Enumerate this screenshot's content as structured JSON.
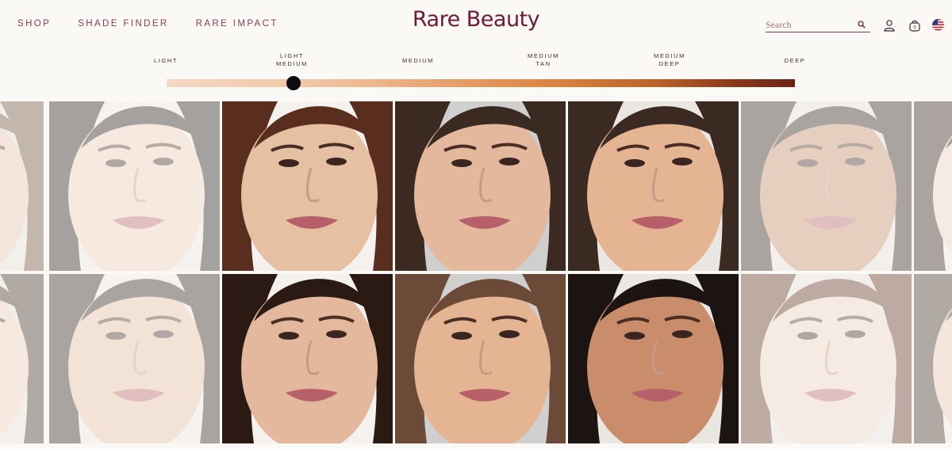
{
  "header": {
    "nav": [
      "SHOP",
      "SHADE FINDER",
      "RARE IMPACT"
    ],
    "logo": "Rare Beauty",
    "search_placeholder": "Search",
    "icons": [
      "search-icon",
      "account-icon",
      "bag-icon",
      "us-flag-icon"
    ],
    "bag_count": "0"
  },
  "shade_finder": {
    "labels": [
      {
        "line1": "LIGHT",
        "line2": ""
      },
      {
        "line1": "LIGHT",
        "line2": "MEDIUM"
      },
      {
        "line1": "MEDIUM",
        "line2": ""
      },
      {
        "line1": "MEDIUM",
        "line2": "TAN"
      },
      {
        "line1": "MEDIUM",
        "line2": "DEEP"
      },
      {
        "line1": "DEEP",
        "line2": ""
      }
    ],
    "selected": "LIGHT MEDIUM",
    "slider_value": 0.2,
    "gradient_colors": [
      "#f5d8c4",
      "#f0c3a2",
      "#e7a06d",
      "#d9843f",
      "#b8632a",
      "#8a3a1c",
      "#6a2216"
    ]
  },
  "colors": {
    "brand": "#6e1a37",
    "nav_text": "#8a3b52",
    "background": "#fbf9f6"
  },
  "grid": {
    "rows": [
      [
        {
          "name": "model-photo",
          "faded": true
        },
        {
          "name": "model-photo",
          "faded": true
        },
        {
          "name": "model-photo",
          "faded": false
        },
        {
          "name": "model-photo",
          "faded": false
        },
        {
          "name": "model-photo",
          "faded": false
        },
        {
          "name": "model-photo",
          "faded": true
        },
        {
          "name": "model-photo",
          "faded": true
        }
      ],
      [
        {
          "name": "model-photo",
          "faded": true
        },
        {
          "name": "model-photo",
          "faded": true
        },
        {
          "name": "model-photo",
          "faded": false
        },
        {
          "name": "model-photo",
          "faded": false
        },
        {
          "name": "model-photo",
          "faded": false
        },
        {
          "name": "model-photo",
          "faded": true
        },
        {
          "name": "model-photo",
          "faded": true
        }
      ]
    ]
  }
}
